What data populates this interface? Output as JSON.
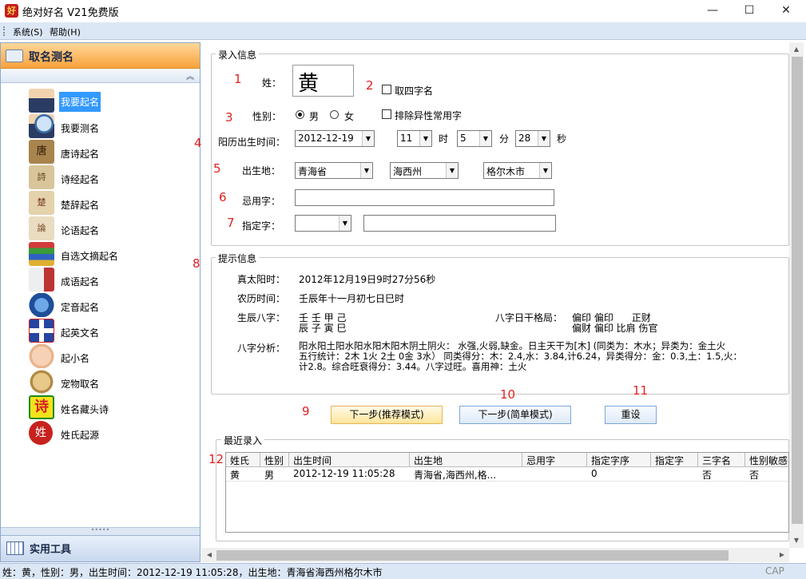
{
  "window": {
    "title": "绝对好名 V21免费版",
    "icon_text": "好",
    "minimize": "—",
    "maximize": "☐",
    "close": "✕"
  },
  "menu": {
    "items": [
      "系统(S)",
      "帮助(H)"
    ]
  },
  "sidebar": {
    "header": "取名测名",
    "collapse_glyph": "︽",
    "items": [
      {
        "label": "我要起名",
        "icon": "person-icon",
        "selected": true
      },
      {
        "label": "我要测名",
        "icon": "magnifier-icon"
      },
      {
        "label": "唐诗起名",
        "icon": "tang-book-icon",
        "icon_text": "唐"
      },
      {
        "label": "诗经起名",
        "icon": "poetry-scroll-icon",
        "icon_text": "詩"
      },
      {
        "label": "楚辞起名",
        "icon": "chuci-scroll-icon",
        "icon_text": "楚"
      },
      {
        "label": "论语起名",
        "icon": "lunyu-scroll-icon",
        "icon_text": "論"
      },
      {
        "label": "自选文摘起名",
        "icon": "books-icon"
      },
      {
        "label": "成语起名",
        "icon": "idiom-scroll-icon"
      },
      {
        "label": "定音起名",
        "icon": "speaker-icon"
      },
      {
        "label": "起英文名",
        "icon": "uk-flag-icon"
      },
      {
        "label": "起小名",
        "icon": "baby-icon"
      },
      {
        "label": "宠物取名",
        "icon": "dog-icon"
      },
      {
        "label": "姓名藏头诗",
        "icon": "poem-icon",
        "icon_text": "诗"
      },
      {
        "label": "姓氏起源",
        "icon": "seal-icon",
        "icon_text": "姓"
      }
    ],
    "splitter_dots": "•••••",
    "footer": "实用工具"
  },
  "input": {
    "legend": "录入信息",
    "surname_label": "姓：",
    "surname_value": "黄",
    "four_char_label": "取四字名",
    "gender_label": "性别：",
    "male": "男",
    "female": "女",
    "exclude_label": "排除异性常用字",
    "birth_label": "阳历出生时间：",
    "date": "2012-12-19",
    "hour": "11",
    "hour_unit": "时",
    "minute": "5",
    "minute_unit": "分",
    "second": "28",
    "second_unit": "秒",
    "place_label": "出生地：",
    "province": "青海省",
    "prefecture": "海西州",
    "city": "格尔木市",
    "avoid_label": "忌用字：",
    "avoid_value": "",
    "assign_label": "指定字：",
    "assign_select": "",
    "assign_value": ""
  },
  "annotations": [
    "1",
    "2",
    "3",
    "4",
    "5",
    "6",
    "7",
    "8",
    "9",
    "10",
    "11",
    "12"
  ],
  "hint": {
    "legend": "提示信息",
    "solar_label": "真太阳时：",
    "solar_value": "2012年12月19日9时27分56秒",
    "lunar_label": "农历时间：",
    "lunar_value": "壬辰年十一月初七日巳时",
    "bazi_label": "生辰八字：",
    "bazi_line1": "壬 壬 甲 己",
    "bazi_line2": "辰 子 寅 巳",
    "pattern_label": "八字日干格局：",
    "pattern_line1": "偏印 偏印      正财",
    "pattern_line2": "偏财 偏印 比肩 伤官",
    "analysis_label": "八字分析：",
    "analysis_line1": "阳水阳土阳水阳水阳木阳木阴土阴火： 水强,火弱,缺金。日主天干为[木] (同类为：木水；异类为：金土火",
    "analysis_line2": "五行统计：2木 1火 2土 0金 3水） 同类得分：木：2.4,水：3.84,计6.24，异类得分：金：0.3,土：1.5,火：",
    "analysis_line3": "计2.8。综合旺衰得分：3.44。八字过旺。喜用神：土火"
  },
  "buttons": {
    "next_recommended": "下一步(推荐模式)",
    "next_simple": "下一步(简单模式)",
    "reset": "重设"
  },
  "recent": {
    "legend": "最近录入",
    "columns": [
      "姓氏",
      "性别",
      "出生时间",
      "出生地",
      "忌用字",
      "指定字序",
      "指定字",
      "三字名",
      "性别敏感"
    ],
    "rows": [
      [
        "黄",
        "男",
        "2012-12-19 11:05:28",
        "青海省,海西州,格...",
        "",
        "0",
        "",
        "否",
        "否"
      ]
    ]
  },
  "scroll": {
    "up": "▲",
    "down": "▼",
    "left": "◀",
    "right": "▶"
  },
  "status": {
    "text": "姓：黄，性别：男，出生时间：2012-12-19 11:05:28，出生地：青海省海西州格尔木市",
    "cap": "CAP"
  }
}
